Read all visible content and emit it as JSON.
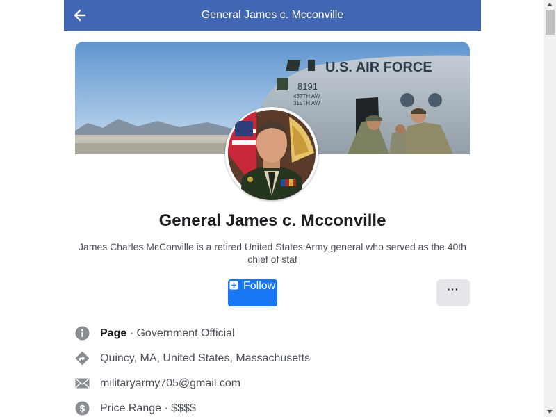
{
  "header": {
    "title": "General James c. Mcconville",
    "back_icon": "back-arrow-icon"
  },
  "cover": {
    "aircraft_text": "U.S. AIR FORCE",
    "tail_number": "8191",
    "unit_line_1": "437TH AW",
    "unit_line_2": "315TH AW"
  },
  "profile": {
    "name": "General James c. Mcconville",
    "bio": "James Charles McConville is a retired United States Army general who served as the 40th chief of staf"
  },
  "actions": {
    "follow_label": "Follow",
    "follow_icon": "add-square-icon",
    "more_label": "···",
    "accent_color": "#1877f2"
  },
  "info": {
    "category_label": "Page",
    "category_value": "· Government Official",
    "location": "Quincy, MA, United States, Massachusetts",
    "email": "militaryarmy705@gmail.com",
    "price_label": "Price Range",
    "price_value": "· $$$$"
  },
  "colors": {
    "header_bg": "#4267b2",
    "text_primary": "#1c1e21",
    "text_secondary": "#4b4f56",
    "icon_gray": "#8a8d91"
  }
}
